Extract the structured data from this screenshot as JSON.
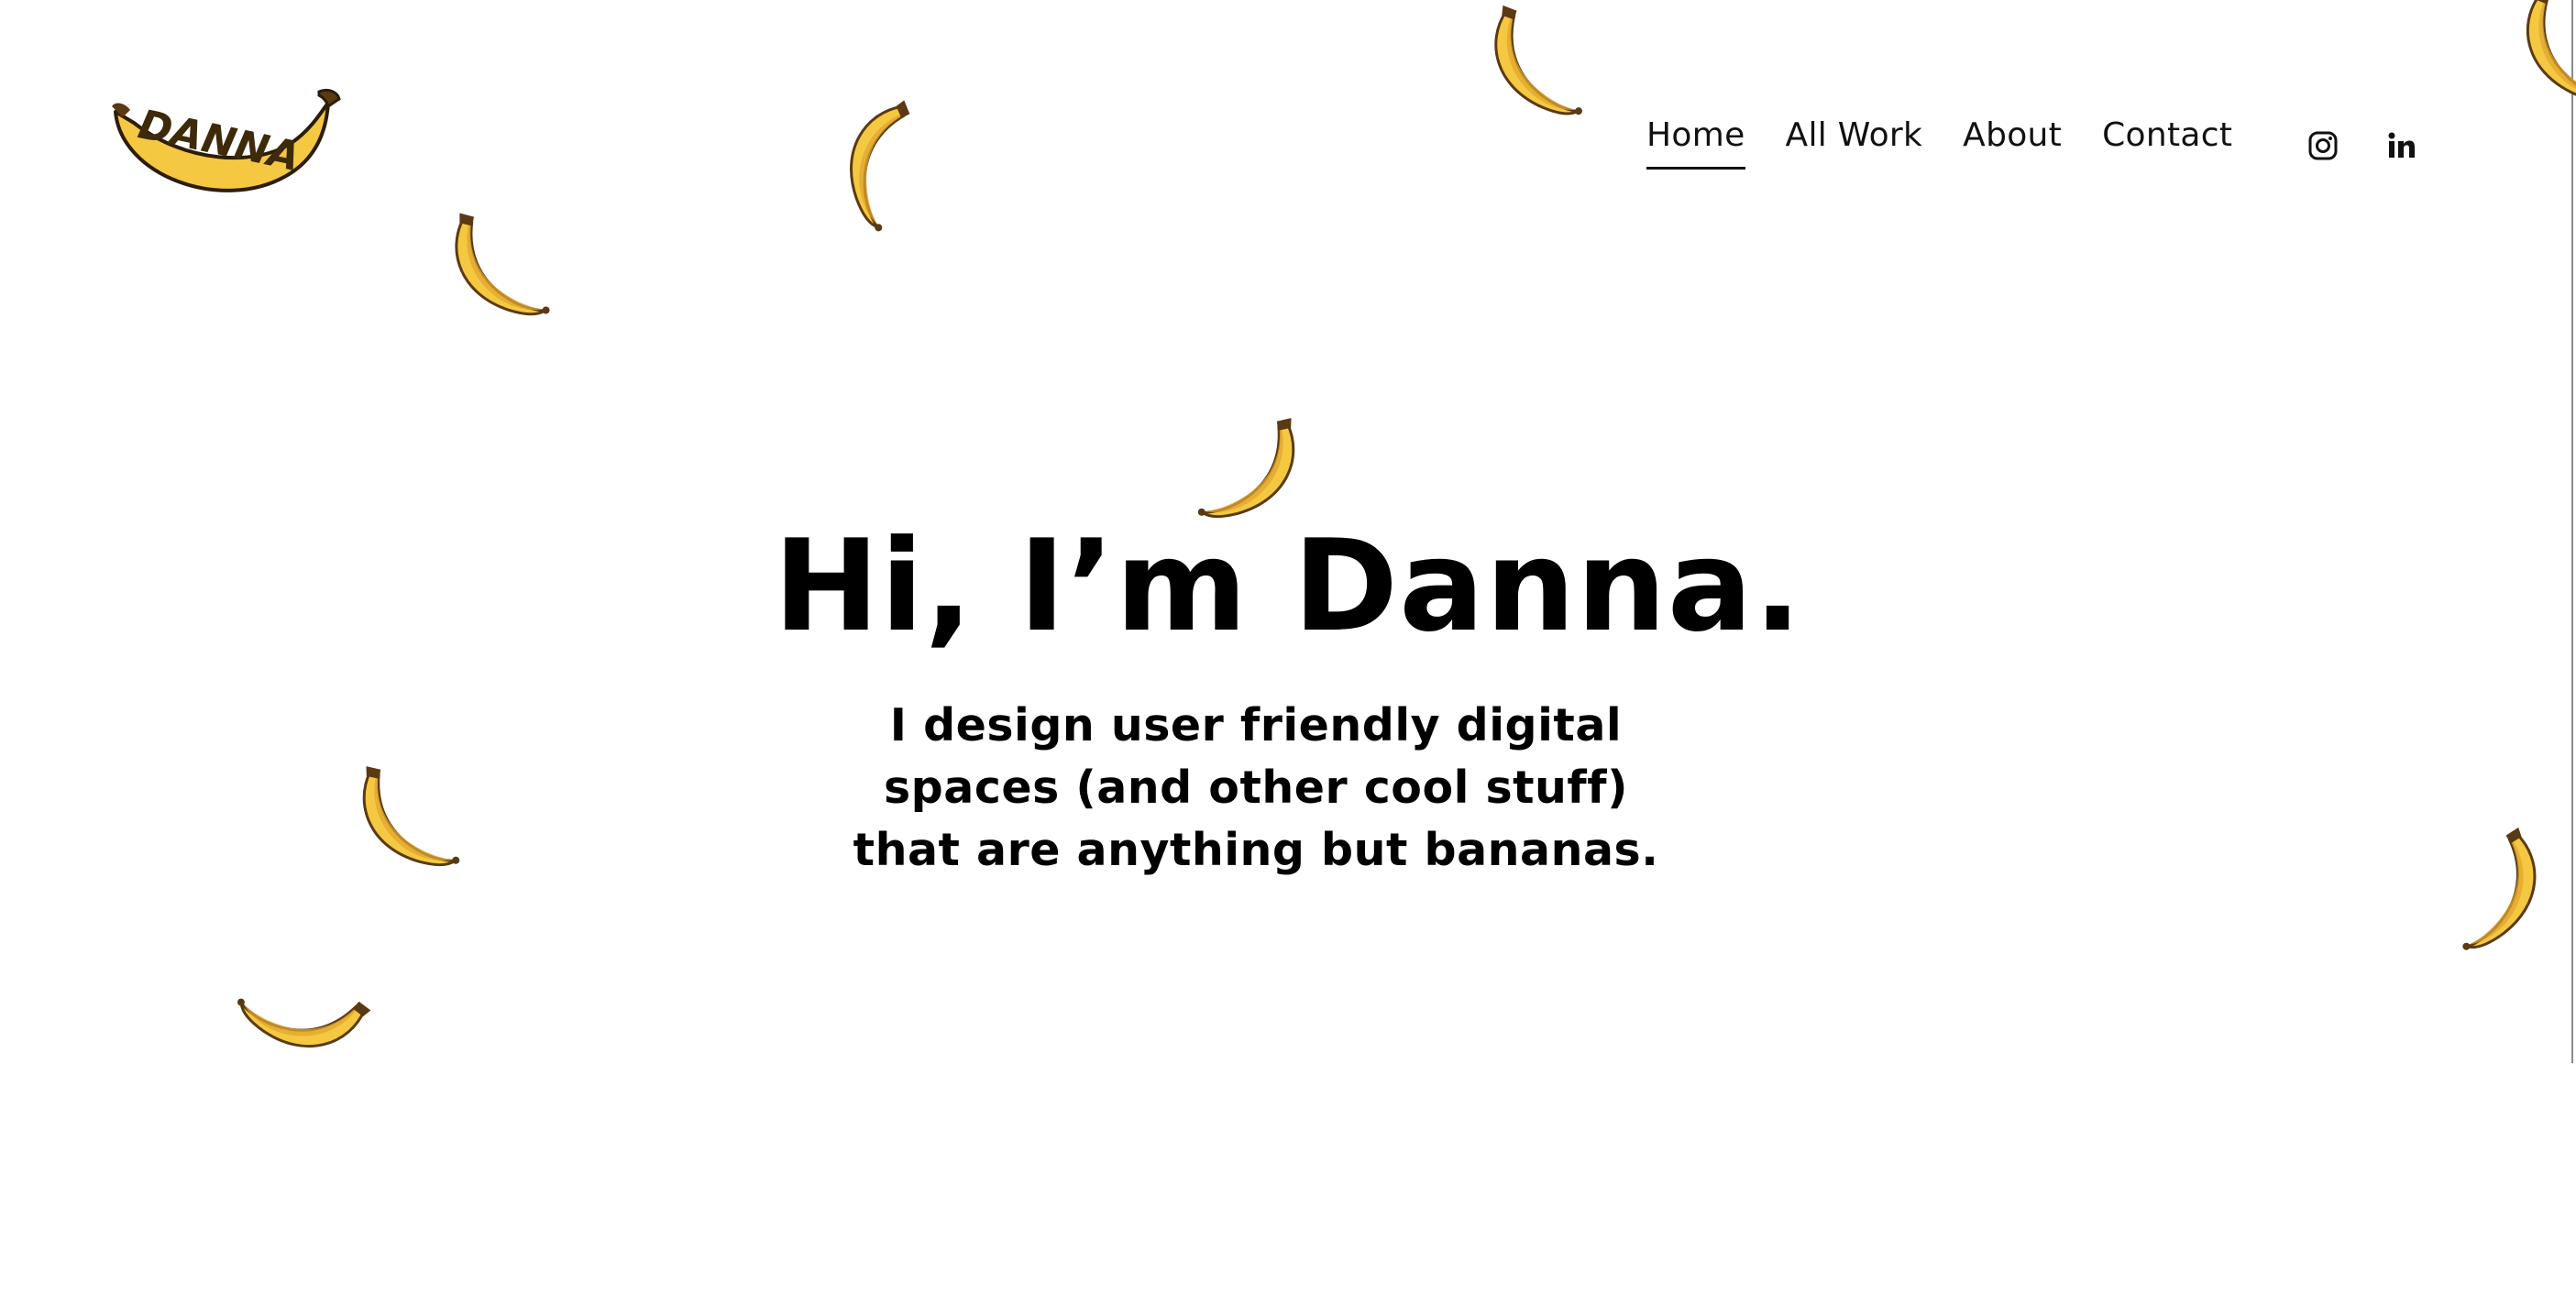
{
  "logo": {
    "text": "DANNA",
    "icon": "banana-logo-icon"
  },
  "nav": {
    "items": [
      {
        "label": "Home",
        "active": true
      },
      {
        "label": "All Work",
        "active": false
      },
      {
        "label": "About",
        "active": false
      },
      {
        "label": "Contact",
        "active": false
      }
    ],
    "social": [
      {
        "name": "instagram-icon"
      },
      {
        "name": "linkedin-icon"
      }
    ]
  },
  "hero": {
    "title": "Hi, I’m Danna.",
    "subtitle_lines": [
      "I design user friendly digital",
      "spaces (and other cool stuff)",
      "that are anything but bananas."
    ]
  },
  "colors": {
    "banana_yellow": "#f5c842",
    "banana_shade": "#e0a52e",
    "banana_outline": "#5a3a12",
    "text": "#000000",
    "background": "#ffffff"
  },
  "decorations": {
    "icon": "banana-icon"
  }
}
